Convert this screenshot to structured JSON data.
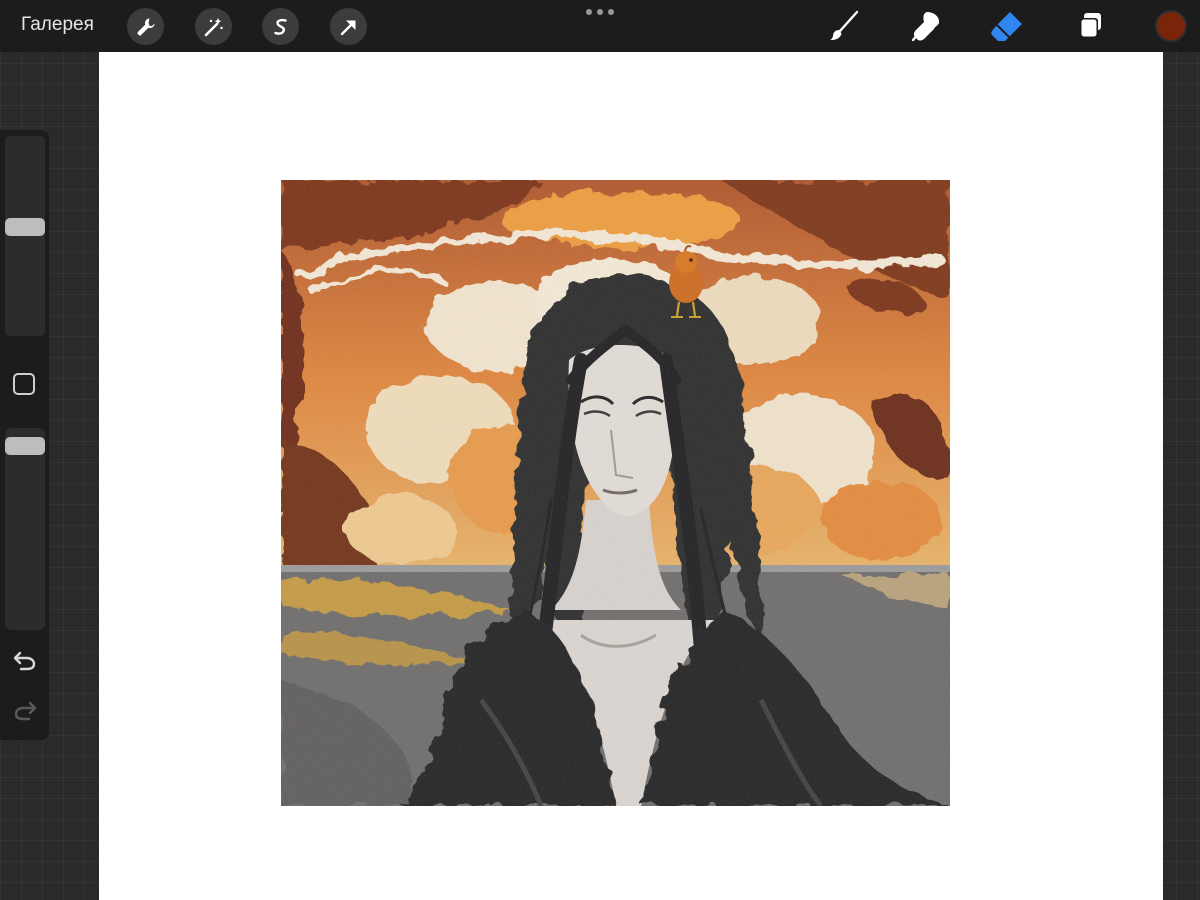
{
  "topbar": {
    "gallery_label": "Галерея",
    "left_tools": [
      "wrench-icon",
      "magic-wand-icon",
      "selection-icon",
      "transform-arrow-icon"
    ],
    "right_tools": [
      "brush-icon",
      "smudge-icon",
      "eraser-icon",
      "layers-icon"
    ],
    "active_tool": "eraser-icon",
    "current_color": "#7a2509"
  },
  "sidebar": {
    "brush_size": 0.55,
    "brush_opacity": 0.95
  },
  "colors": {
    "accent_blue": "#2f86f0",
    "toolbar_bg": "#1c1c1d",
    "canvas_bg": "#ffffff"
  }
}
